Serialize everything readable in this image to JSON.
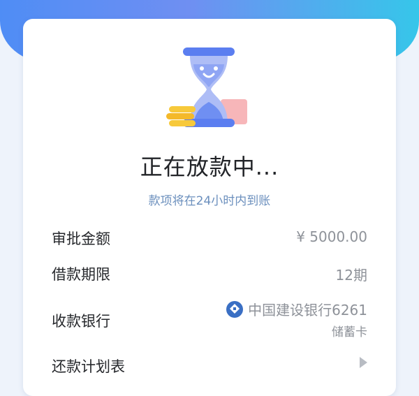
{
  "status": {
    "title": "正在放款中...",
    "subtitle": "款项将在24小时内到账"
  },
  "details": {
    "amount_label": "审批金额",
    "amount_value": "¥ 5000.00",
    "term_label": "借款期限",
    "term_value": "12期",
    "bank_label": "收款银行",
    "bank_name": "中国建设银行6261",
    "card_type": "储蓄卡",
    "schedule_label": "还款计划表"
  },
  "icons": {
    "illustration": "hourglass-with-coins-icon",
    "bank_logo": "ccb-bank-icon",
    "schedule_arrow": "chevron-right-icon"
  },
  "colors": {
    "header_gradient_start": "#4f8df5",
    "header_gradient_end": "#36c6ea",
    "subtitle": "#6b8fbd",
    "value_text": "#8e9299",
    "bank_logo": "#3a6fc4"
  }
}
